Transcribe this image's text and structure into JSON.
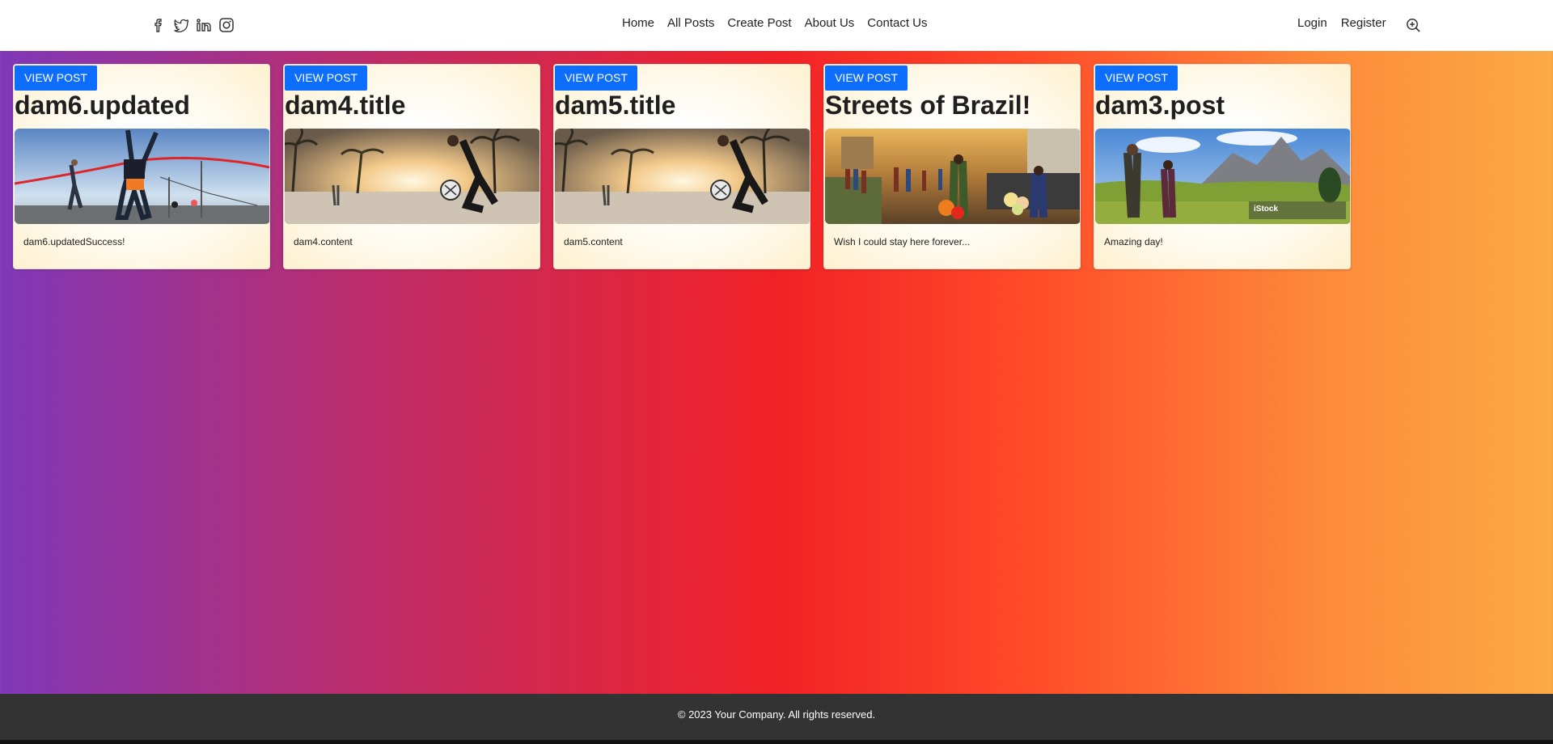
{
  "nav": {
    "social_icons": [
      "facebook-icon",
      "twitter-icon",
      "linkedin-icon",
      "instagram-icon"
    ],
    "links": [
      "Home",
      "All Posts",
      "Create Post",
      "About Us",
      "Contact Us"
    ],
    "login": "Login",
    "register": "Register",
    "zoom_icon": "zoom-in-icon"
  },
  "posts": [
    {
      "button": "VIEW POST",
      "title": "dam6.updated",
      "content": "dam6.updatedSuccess!",
      "image": "marathon finish line"
    },
    {
      "button": "VIEW POST",
      "title": "dam4.title",
      "content": "dam4.content",
      "image": "beach football at sunset"
    },
    {
      "button": "VIEW POST",
      "title": "dam5.title",
      "content": "dam5.content",
      "image": "beach football at sunset"
    },
    {
      "button": "VIEW POST",
      "title": "Streets of Brazil!",
      "content": "Wish I could stay here forever...",
      "image": "busy street market"
    },
    {
      "button": "VIEW POST",
      "title": "dam3.post",
      "content": "Amazing day!",
      "image": "hikers in mountain meadow",
      "watermark": "iStock"
    }
  ],
  "footer": {
    "text": "© 2023 Your Company. All rights reserved."
  },
  "colors": {
    "button": "#0d6efd",
    "footer": "#333333",
    "navbar": "#ffffff"
  }
}
